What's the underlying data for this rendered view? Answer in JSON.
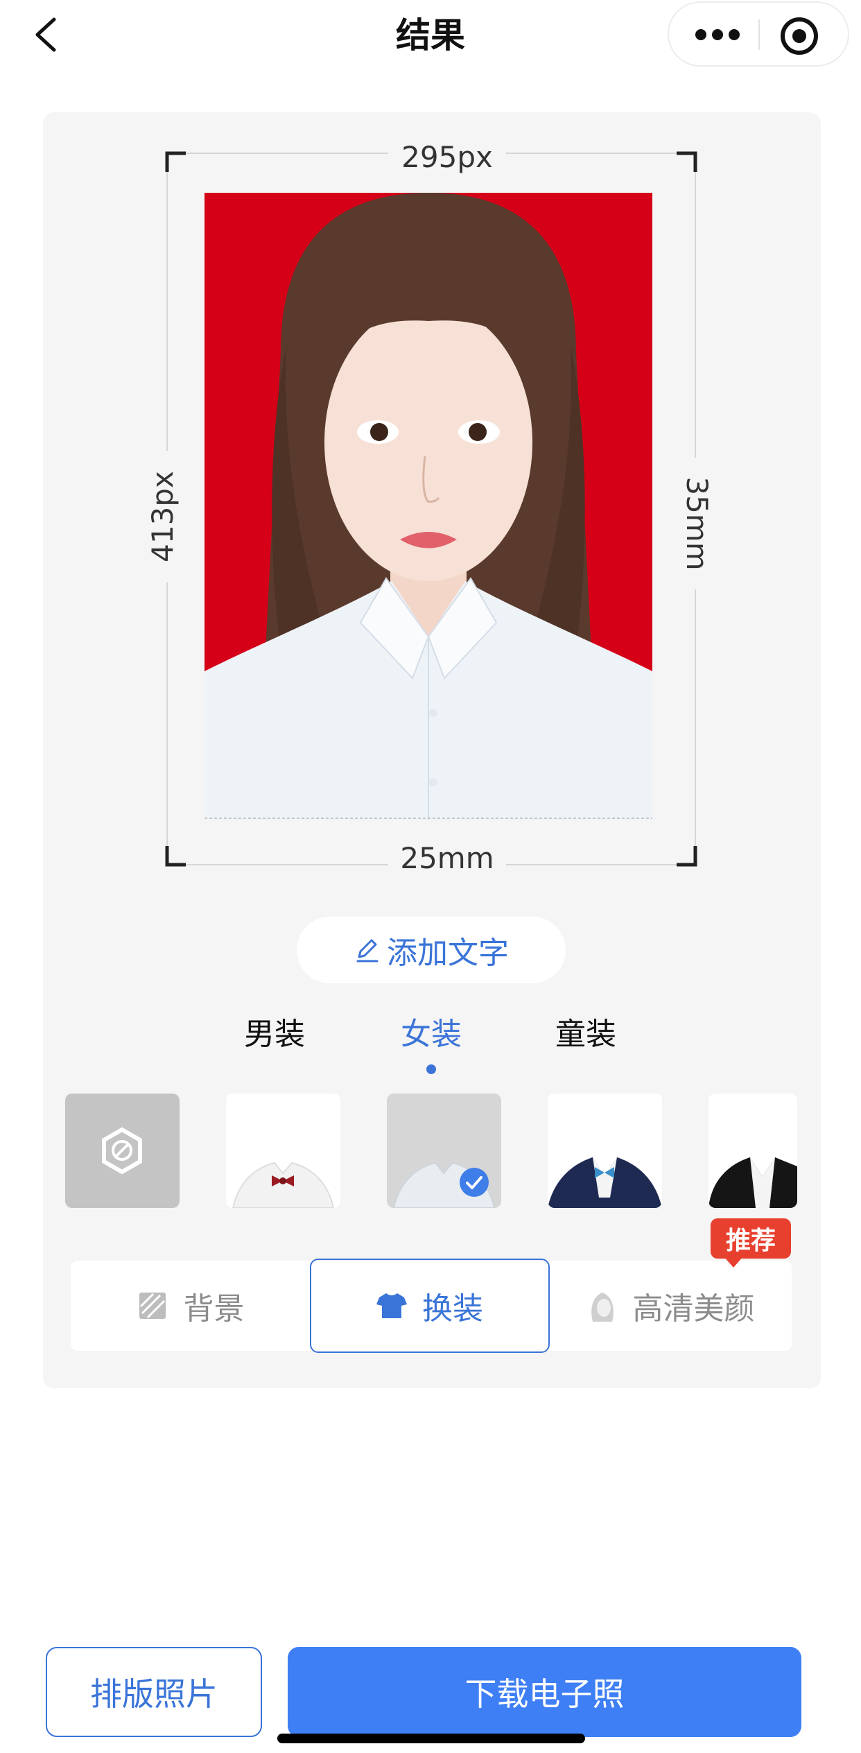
{
  "header": {
    "title": "结果",
    "back_icon": "chevron-left-icon",
    "more_icon": "more-dots-icon",
    "close_icon": "target-circle-icon"
  },
  "photo": {
    "width_px": "295px",
    "height_px": "413px",
    "width_mm": "25mm",
    "height_mm": "35mm",
    "background_color": "#d50018"
  },
  "add_text": {
    "label": "添加文字",
    "icon": "pencil-icon"
  },
  "categories": {
    "items": [
      {
        "label": "男装"
      },
      {
        "label": "女装"
      },
      {
        "label": "童装"
      }
    ],
    "selected": "女装"
  },
  "outfits": {
    "items": [
      {
        "name": "none",
        "icon": "disable-icon"
      },
      {
        "name": "white-shirt-red-bowtie"
      },
      {
        "name": "white-shirt",
        "selected": true
      },
      {
        "name": "navy-suit-blue-bowtie"
      },
      {
        "name": "black-suit-white-shirt"
      }
    ]
  },
  "func_tabs": {
    "items": [
      {
        "label": "背景",
        "icon": "background-icon"
      },
      {
        "label": "换装",
        "icon": "shirt-icon"
      },
      {
        "label": "高清美颜",
        "icon": "face-icon"
      }
    ],
    "selected": "换装",
    "badge": "推荐"
  },
  "footer": {
    "layout_button": "排版照片",
    "download_button": "下载电子照"
  },
  "colors": {
    "accent": "#3a74d8",
    "primary_button": "#3f7ff5",
    "badge": "#e8402f"
  }
}
